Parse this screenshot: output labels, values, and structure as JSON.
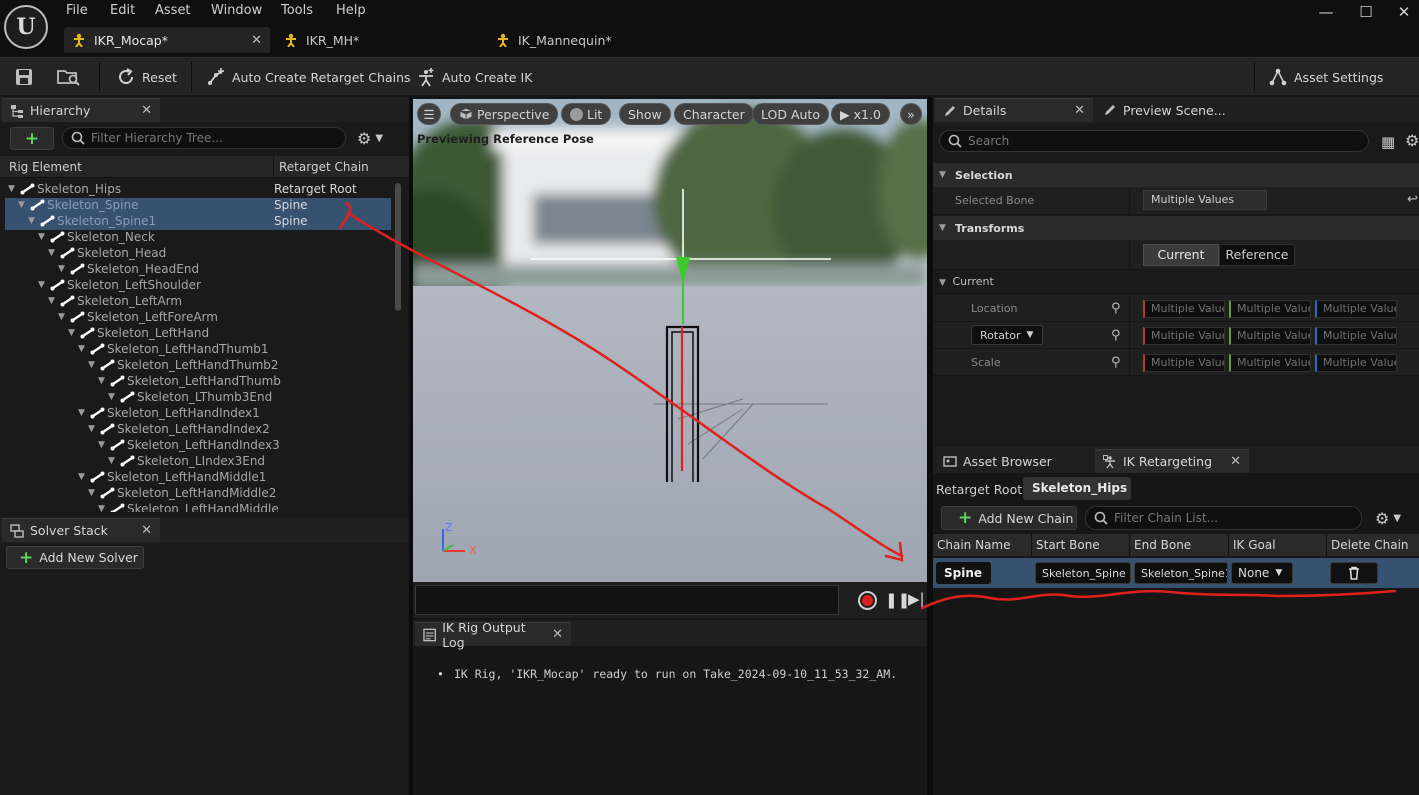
{
  "menu": [
    "File",
    "Edit",
    "Asset",
    "Window",
    "Tools",
    "Help"
  ],
  "tabs": [
    {
      "label": "IKR_Mocap*",
      "active": true
    },
    {
      "label": "IKR_MH*",
      "active": false
    },
    {
      "label": "IK_Mannequin*",
      "active": false
    }
  ],
  "toolbar": {
    "reset": "Reset",
    "auto_chains": "Auto Create Retarget Chains",
    "auto_ik": "Auto Create IK",
    "asset_settings": "Asset Settings"
  },
  "hierarchy": {
    "tab": "Hierarchy",
    "search_placeholder": "Filter Hierarchy Tree...",
    "col_element": "Rig Element",
    "col_chain": "Retarget Chain",
    "rows": [
      {
        "name": "Skeleton_Hips",
        "depth": 0,
        "chain": "Retarget Root",
        "selected": false
      },
      {
        "name": "Skeleton_Spine",
        "depth": 1,
        "chain": "Spine",
        "selected": true
      },
      {
        "name": "Skeleton_Spine1",
        "depth": 2,
        "chain": "Spine",
        "selected": true
      },
      {
        "name": "Skeleton_Neck",
        "depth": 3,
        "chain": "",
        "selected": false
      },
      {
        "name": "Skeleton_Head",
        "depth": 4,
        "chain": "",
        "selected": false
      },
      {
        "name": "Skeleton_HeadEnd",
        "depth": 5,
        "chain": "",
        "selected": false
      },
      {
        "name": "Skeleton_LeftShoulder",
        "depth": 3,
        "chain": "",
        "selected": false
      },
      {
        "name": "Skeleton_LeftArm",
        "depth": 4,
        "chain": "",
        "selected": false
      },
      {
        "name": "Skeleton_LeftForeArm",
        "depth": 5,
        "chain": "",
        "selected": false
      },
      {
        "name": "Skeleton_LeftHand",
        "depth": 6,
        "chain": "",
        "selected": false
      },
      {
        "name": "Skeleton_LeftHandThumb1",
        "depth": 7,
        "chain": "",
        "selected": false
      },
      {
        "name": "Skeleton_LeftHandThumb2",
        "depth": 8,
        "chain": "",
        "selected": false
      },
      {
        "name": "Skeleton_LeftHandThumb",
        "depth": 9,
        "chain": "",
        "selected": false
      },
      {
        "name": "Skeleton_LThumb3End",
        "depth": 10,
        "chain": "",
        "selected": false
      },
      {
        "name": "Skeleton_LeftHandIndex1",
        "depth": 7,
        "chain": "",
        "selected": false
      },
      {
        "name": "Skeleton_LeftHandIndex2",
        "depth": 8,
        "chain": "",
        "selected": false
      },
      {
        "name": "Skeleton_LeftHandIndex3",
        "depth": 9,
        "chain": "",
        "selected": false
      },
      {
        "name": "Skeleton_LIndex3End",
        "depth": 10,
        "chain": "",
        "selected": false
      },
      {
        "name": "Skeleton_LeftHandMiddle1",
        "depth": 7,
        "chain": "",
        "selected": false
      },
      {
        "name": "Skeleton_LeftHandMiddle2",
        "depth": 8,
        "chain": "",
        "selected": false
      },
      {
        "name": "Skeleton_LeftHandMiddle",
        "depth": 9,
        "chain": "",
        "selected": false
      }
    ]
  },
  "solver": {
    "tab": "Solver Stack",
    "add": "Add New Solver"
  },
  "viewport": {
    "perspective": "Perspective",
    "lit": "Lit",
    "show": "Show",
    "character": "Character",
    "lod": "LOD Auto",
    "speed": "x1.0",
    "status": "Previewing Reference Pose",
    "axis_z": "Z",
    "axis_x": "X"
  },
  "log": {
    "tab": "IK Rig Output Log",
    "message": "IK Rig, 'IKR_Mocap' ready to run on Take_2024-09-10_11_53_32_AM."
  },
  "details": {
    "tab": "Details",
    "tab2": "Preview Scene...",
    "search_placeholder": "Search",
    "selection": "Selection",
    "selected_bone_label": "Selected Bone",
    "selected_bone_value": "Multiple Values",
    "transforms": "Transforms",
    "current_btn": "Current",
    "reference_btn": "Reference",
    "current_group": "Current",
    "location": "Location",
    "rotator": "Rotator",
    "scale": "Scale",
    "multiple": "Multiple Values"
  },
  "retarget": {
    "tab_asset_browser": "Asset Browser",
    "tab_ik": "IK Retargeting",
    "root_label": "Retarget Root:",
    "root_value": "Skeleton_Hips",
    "add_chain": "Add New Chain",
    "filter_placeholder": "Filter Chain List...",
    "columns": [
      "Chain Name",
      "Start Bone",
      "End Bone",
      "IK Goal",
      "Delete Chain"
    ],
    "rows": [
      {
        "chain": "Spine",
        "start": "Skeleton_Spine",
        "end": "Skeleton_Spine1",
        "goal": "None"
      }
    ]
  },
  "colors": {
    "selection": "#375170",
    "annotation": "#e0201c",
    "accent_green": "#5fd35f"
  }
}
